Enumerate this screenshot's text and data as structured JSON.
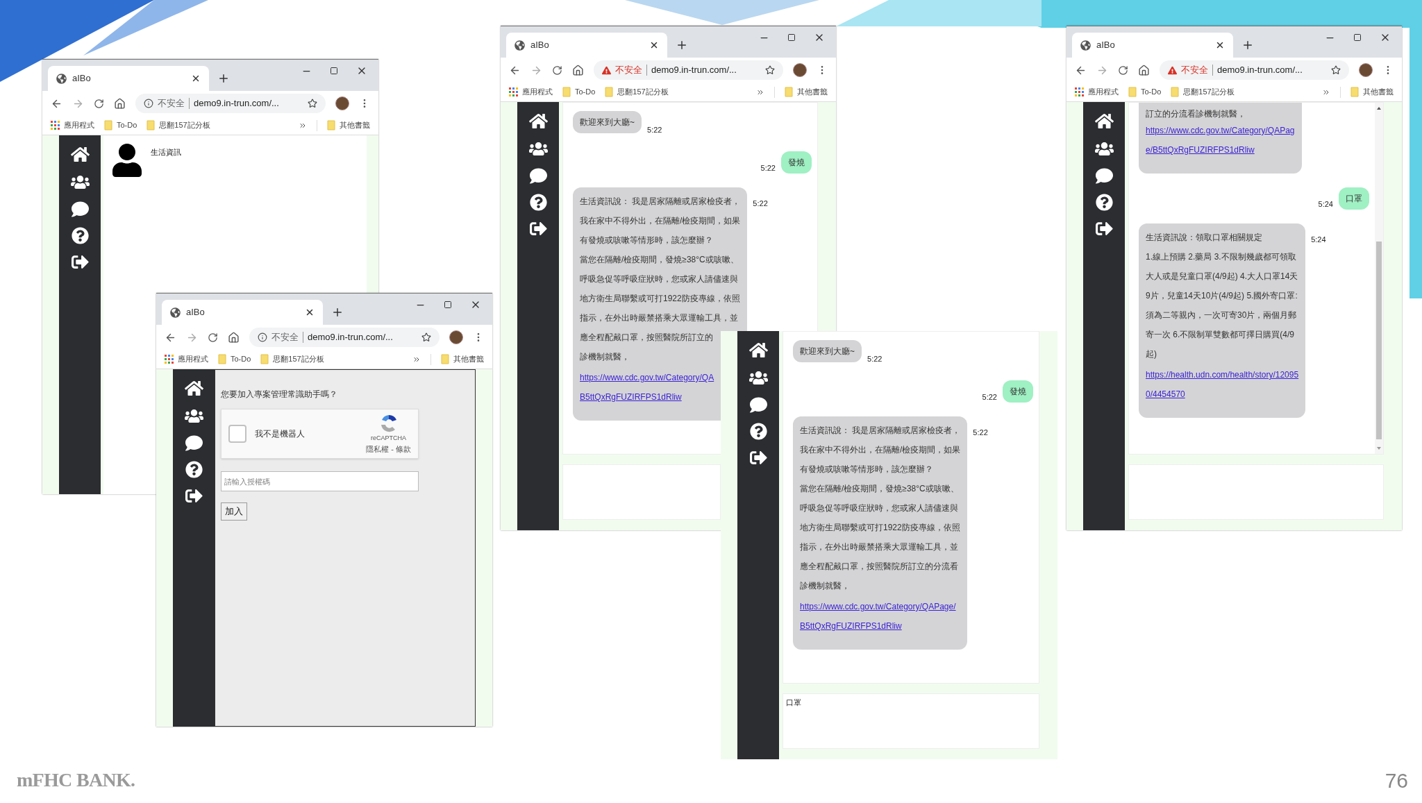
{
  "slide": {
    "logo": "mFHC BANK.",
    "page_number": "76"
  },
  "windows": [
    {
      "kind": "browser",
      "tab_title": "aIBo",
      "warning": false,
      "security_label": "不安全",
      "url": "demo9.in-trun.com/...",
      "bookmarks": [
        {
          "kind": "apps",
          "label": "應用程式"
        },
        {
          "kind": "folder",
          "label": "To-Do"
        },
        {
          "kind": "folder",
          "label": "思翻157記分板"
        }
      ],
      "other_bookmarks": "其他書籤",
      "page": {
        "kind": "profile",
        "name": "生活資訊"
      }
    },
    {
      "kind": "browser",
      "tab_title": "aIBo",
      "warning": false,
      "security_label": "不安全",
      "url": "demo9.in-trun.com/...",
      "bookmarks": [
        {
          "kind": "apps",
          "label": "應用程式"
        },
        {
          "kind": "folder",
          "label": "To-Do"
        },
        {
          "kind": "folder",
          "label": "思翻157記分板"
        }
      ],
      "other_bookmarks": "其他書籤",
      "page": {
        "kind": "join",
        "question": "您要加入專案管理常識助手嗎？",
        "captcha": {
          "checked": false,
          "label": "我不是機器人",
          "brand": "reCAPTCHA",
          "terms": "隱私權 - 條款"
        },
        "code_placeholder": "請輸入授權碼",
        "submit": "加入"
      }
    },
    {
      "kind": "browser",
      "tab_title": "aIBo",
      "warning": true,
      "security_label": "不安全",
      "url": "demo9.in-trun.com/...",
      "bookmarks": [
        {
          "kind": "apps",
          "label": "應用程式"
        },
        {
          "kind": "folder",
          "label": "To-Do"
        },
        {
          "kind": "folder",
          "label": "思翻157記分板"
        }
      ],
      "other_bookmarks": "其他書籤",
      "page": {
        "kind": "chat",
        "messages": [
          {
            "kind": "bot",
            "text": [
              "歡迎來到大廳~"
            ],
            "time": "5:22"
          },
          {
            "kind": "user",
            "text": [
              "發燒"
            ],
            "time": "5:22"
          },
          {
            "kind": "bot",
            "text": [
              "生活資訊說： 我是居家隔離或居家檢疫者，",
              "我在家中不得外出，在隔離/檢疫期間，如果",
              "有發燒或咳嗽等情形時，該怎麼辦？",
              "當您在隔離/檢疫期間，發燒≥38°C或咳嗽、",
              "呼吸急促等呼吸症狀時，您或家人請儘速與",
              "地方衛生局聯繫或可打1922防疫專線，依照",
              "指示，在外出時嚴禁搭乘大眾運輸工具，並",
              "應全程配戴口罩，按照醫院所訂立的",
              "診機制就醫，"
            ],
            "link": [
              "https://www.cdc.gov.tw/Category/QA",
              "B5ttQxRgFUZIRFPS1dRliw"
            ],
            "time": "5:22"
          }
        ]
      }
    },
    {
      "kind": "page",
      "page": {
        "kind": "chat",
        "input_value": "口罩",
        "messages": [
          {
            "kind": "bot",
            "text": [
              "歡迎來到大廳~"
            ],
            "time": "5:22"
          },
          {
            "kind": "user",
            "text": [
              "發燒"
            ],
            "time": "5:22"
          },
          {
            "kind": "bot",
            "text": [
              "生活資訊說： 我是居家隔離或居家檢疫者，",
              "我在家中不得外出，在隔離/檢疫期間，如果",
              "有發燒或咳嗽等情形時，該怎麼辦？",
              "當您在隔離/檢疫期間，發燒≥38°C或咳嗽、",
              "呼吸急促等呼吸症狀時，您或家人請儘速與",
              "地方衛生局聯繫或可打1922防疫專線，依照",
              "指示，在外出時嚴禁搭乘大眾運輸工具，並",
              "應全程配戴口罩，按照醫院所訂立的分流看",
              "診機制就醫，"
            ],
            "link": [
              "https://www.cdc.gov.tw/Category/QAPage/",
              "B5ttQxRgFUZIRFPS1dRliw"
            ],
            "time": "5:22"
          }
        ]
      }
    },
    {
      "kind": "browser",
      "tab_title": "aIBo",
      "warning": true,
      "security_label": "不安全",
      "url": "demo9.in-trun.com/...",
      "bookmarks": [
        {
          "kind": "apps",
          "label": "應用程式"
        },
        {
          "kind": "folder",
          "label": "To-Do"
        },
        {
          "kind": "folder",
          "label": "思翻157記分板"
        }
      ],
      "other_bookmarks": "其他書籤",
      "page": {
        "kind": "chat",
        "scrollbar": true,
        "messages": [
          {
            "kind": "bot",
            "cut_top": true,
            "text": [
              "訂立的分流看診機制就醫，"
            ],
            "link": [
              "https://www.cdc.gov.tw/Category/QAPag",
              "e/B5ttQxRgFUZIRFPS1dRliw"
            ]
          },
          {
            "kind": "user",
            "text": [
              "口罩"
            ],
            "time": "5:24"
          },
          {
            "kind": "bot",
            "text": [
              "生活資訊說：領取口罩相關規定",
              "1.線上預購 2.藥局 3.不限制幾歲都可領取",
              "大人或是兒童口罩(4/9起) 4.大人口罩14天",
              "9片，兒童14天10片(4/9起) 5.國外寄口罩:",
              "須為二等親內，一次可寄30片，兩個月郵",
              "寄一次 6.不限制單雙數都可擇日購買(4/9",
              "起)"
            ],
            "link": [
              "https://health.udn.com/health/story/12095",
              "0/4454570"
            ],
            "time": "5:24"
          }
        ]
      }
    }
  ]
}
